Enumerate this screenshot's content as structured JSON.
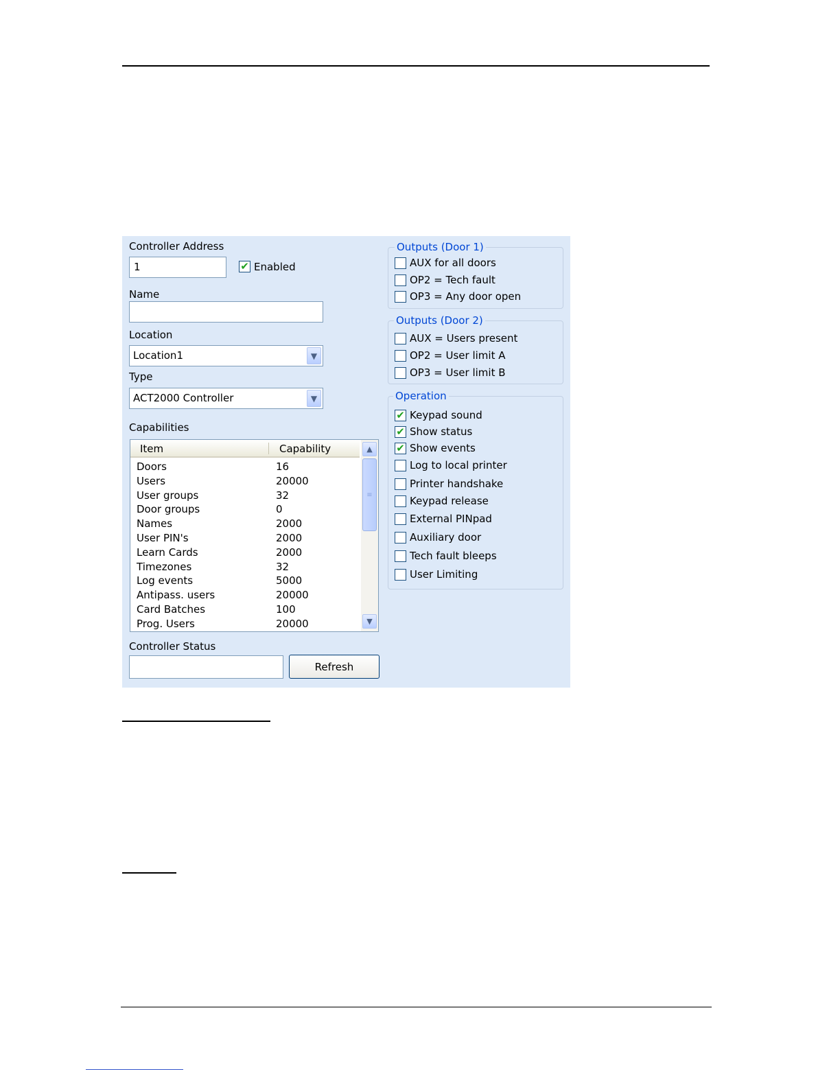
{
  "panel": {
    "controller_address_label": "Controller Address",
    "controller_address_value": "1",
    "enabled_label": "Enabled",
    "enabled_checked": true,
    "name_label": "Name",
    "name_value": "",
    "location_label": "Location",
    "location_value": "Location1",
    "type_label": "Type",
    "type_value": "ACT2000 Controller",
    "capabilities_label": "Capabilities",
    "capabilities": {
      "columns": [
        "Item",
        "Capability"
      ],
      "rows": [
        {
          "item": "Doors",
          "capability": "16"
        },
        {
          "item": "Users",
          "capability": "20000"
        },
        {
          "item": "User groups",
          "capability": "32"
        },
        {
          "item": "Door groups",
          "capability": "0"
        },
        {
          "item": "Names",
          "capability": "2000"
        },
        {
          "item": "User PIN's",
          "capability": "2000"
        },
        {
          "item": "Learn Cards",
          "capability": "2000"
        },
        {
          "item": "Timezones",
          "capability": "32"
        },
        {
          "item": "Log events",
          "capability": "5000"
        },
        {
          "item": "Antipass. users",
          "capability": "20000"
        },
        {
          "item": "Card Batches",
          "capability": "100"
        },
        {
          "item": "Prog. Users",
          "capability": "20000"
        }
      ]
    },
    "controller_status_label": "Controller Status",
    "controller_status_value": "",
    "refresh_label": "Refresh"
  },
  "outputs_door1": {
    "title": "Outputs (Door 1)",
    "options": [
      {
        "label": "AUX for all doors",
        "checked": false
      },
      {
        "label": "OP2 = Tech fault",
        "checked": false
      },
      {
        "label": "OP3 = Any door open",
        "checked": false
      }
    ]
  },
  "outputs_door2": {
    "title": "Outputs (Door 2)",
    "options": [
      {
        "label": "AUX = Users present",
        "checked": false
      },
      {
        "label": "OP2 = User limit A",
        "checked": false
      },
      {
        "label": "OP3 = User limit B",
        "checked": false
      }
    ]
  },
  "operation": {
    "title": "Operation",
    "options": [
      {
        "label": "Keypad sound",
        "checked": true
      },
      {
        "label": "Show status",
        "checked": true
      },
      {
        "label": "Show events",
        "checked": true
      },
      {
        "label": "Log to local printer",
        "checked": false
      },
      {
        "label": "Printer handshake",
        "checked": false
      },
      {
        "label": "Keypad release",
        "checked": false
      },
      {
        "label": "External PINpad",
        "checked": false
      },
      {
        "label": "Auxiliary door",
        "checked": false
      },
      {
        "label": "Tech fault bleeps",
        "checked": false
      },
      {
        "label": "User Limiting",
        "checked": false
      }
    ]
  },
  "icons": {
    "check": "✔",
    "dropdown_arrow": "▼",
    "scroll_up": "▲",
    "scroll_down": "▼",
    "grip": "≡"
  },
  "colors": {
    "panel_bg": "#dde9f8",
    "group_title": "#0046d5",
    "checkmark": "#21a121"
  }
}
